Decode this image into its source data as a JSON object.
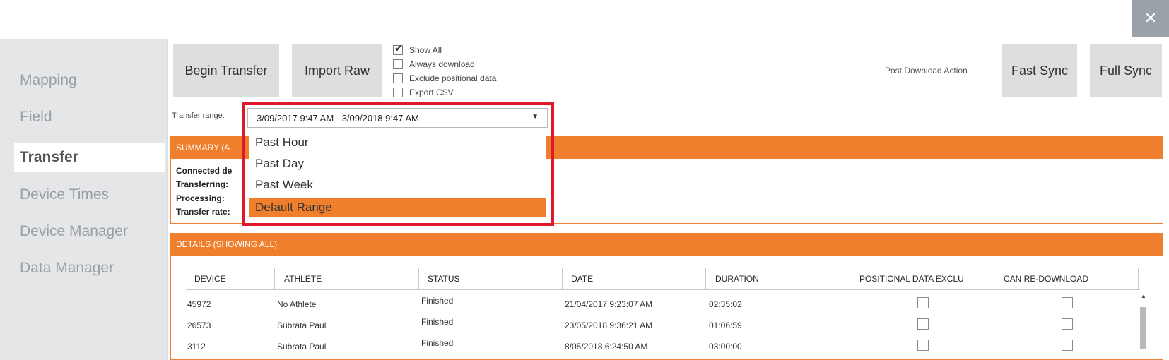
{
  "window": {
    "close_glyph": "✕"
  },
  "sidebar": {
    "items": [
      {
        "label": "Mapping",
        "active": false
      },
      {
        "label": "Field",
        "active": false
      },
      {
        "label": "Transfer",
        "active": true
      },
      {
        "label": "Device Times",
        "active": false
      },
      {
        "label": "Device Manager",
        "active": false
      },
      {
        "label": "Data Manager",
        "active": false
      }
    ]
  },
  "toolbar": {
    "begin_transfer": "Begin Transfer",
    "import_raw": "Import Raw",
    "options": [
      {
        "label": "Show All",
        "checked": true
      },
      {
        "label": "Always download",
        "checked": false
      },
      {
        "label": "Exclude positional data",
        "checked": false
      },
      {
        "label": "Export CSV",
        "checked": false
      }
    ],
    "post_download_label": "Post Download Action",
    "fast_sync": "Fast Sync",
    "full_sync": "Full Sync"
  },
  "transfer_range": {
    "label": "Transfer range:",
    "value": "3/09/2017 9:47 AM - 3/09/2018 9:47 AM",
    "dropdown_icon": "chevron-down-icon",
    "options": [
      "Past Hour",
      "Past Day",
      "Past Week",
      "Default Range"
    ],
    "selected_option": "Default Range"
  },
  "summary": {
    "header": "SUMMARY (A",
    "lines": [
      "Connected de",
      "Transferring:",
      "Processing:",
      "Transfer rate:"
    ]
  },
  "details": {
    "header": "DETAILS (SHOWING ALL)",
    "columns": [
      "DEVICE",
      "ATHLETE",
      "STATUS",
      "DATE",
      "DURATION",
      "POSITIONAL DATA EXCLU",
      "CAN RE-DOWNLOAD"
    ],
    "rows": [
      {
        "device": "45972",
        "athlete": "No Athlete",
        "status": "Finished",
        "date": "21/04/2017 9:23:07 AM",
        "duration": "02:35:02",
        "positional_excluded": false,
        "can_redownload": false
      },
      {
        "device": "26573",
        "athlete": "Subrata Paul",
        "status": "Finished",
        "date": "23/05/2018 9:36:21 AM",
        "duration": "01:06:59",
        "positional_excluded": false,
        "can_redownload": false
      },
      {
        "device": "3112",
        "athlete": "Subrata Paul",
        "status": "Finished",
        "date": "8/05/2018 6:24:50 AM",
        "duration": "03:00:00",
        "positional_excluded": false,
        "can_redownload": false
      }
    ]
  },
  "colors": {
    "accent_orange": "#ef7f2d",
    "highlight_red": "#e0192a",
    "sidebar_bg": "#e4e6e8",
    "button_bg": "#dcdee0"
  }
}
